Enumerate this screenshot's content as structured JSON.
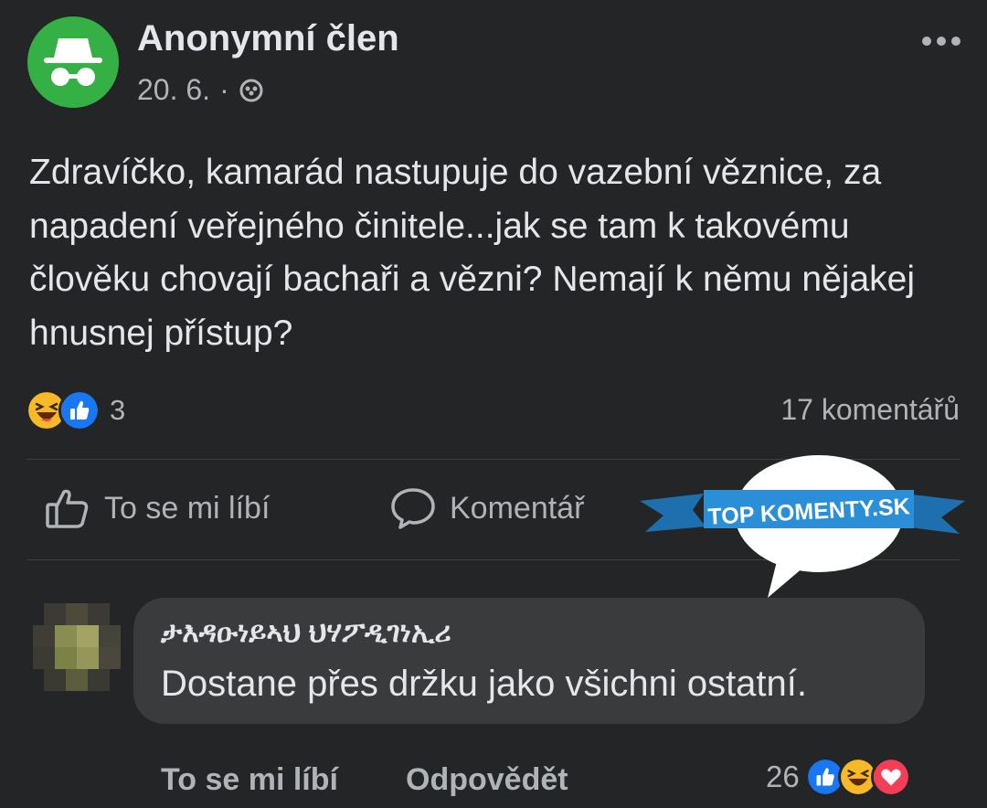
{
  "post": {
    "author": "Anonymní člen",
    "date": "20. 6.",
    "separator": "·",
    "text": "Zdravíčko, kamarád nastupuje do vazební věznice, za napadení veřejného činitele...jak se tam k takovému člověku chovají bachaři a vězni? Nemají k němu nějakej hnusnej přístup?",
    "reaction_count": "3",
    "comment_count": "17 komentářů"
  },
  "actions": {
    "like": "To se mi líbí",
    "comment": "Komentář"
  },
  "comment": {
    "author": "ታእዳዑነይኣህ ህሃፖዲገነኢሪ",
    "text": "Dostane přes držku jako všichni ostatní.",
    "like": "To se mi líbí",
    "reply": "Odpovědět",
    "reaction_count": "26"
  },
  "watermark": {
    "text": "TOP KOMENTY.SK"
  },
  "icons": {
    "avatar": "incognito-icon",
    "privacy": "group-privacy-icon",
    "more": "more-options-icon",
    "haha": "haha-reaction-icon",
    "like": "like-reaction-icon",
    "love": "love-reaction-icon"
  },
  "colors": {
    "background": "#242526",
    "bubble": "#3a3b3c",
    "avatar_green": "#35b044",
    "like_blue": "#1877f2",
    "haha_yellow": "#f7b928",
    "love_red": "#f33e58",
    "ribbon_blue": "#2a8fd6"
  }
}
